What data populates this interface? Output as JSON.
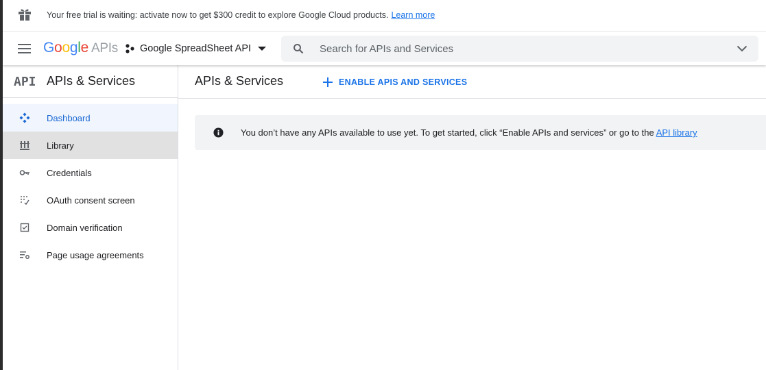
{
  "banner": {
    "text": "Your free trial is waiting: activate now to get $300 credit to explore Google Cloud products.",
    "link_label": "Learn more",
    "icon": "gift-icon"
  },
  "header": {
    "logo_google": [
      "G",
      "o",
      "o",
      "g",
      "l",
      "e"
    ],
    "logo_suffix": "APIs",
    "project_name": "Google SpreadSheet API",
    "search_placeholder": "Search for APIs and Services",
    "search_value": ""
  },
  "sidebar": {
    "header_glyph": "API",
    "title": "APIs & Services",
    "items": [
      {
        "label": "Dashboard",
        "icon": "dashboard-icon",
        "active": true
      },
      {
        "label": "Library",
        "icon": "library-icon",
        "hovered": true
      },
      {
        "label": "Credentials",
        "icon": "key-icon"
      },
      {
        "label": "OAuth consent screen",
        "icon": "consent-screen-icon"
      },
      {
        "label": "Domain verification",
        "icon": "checkbox-icon"
      },
      {
        "label": "Page usage agreements",
        "icon": "settings-list-icon"
      }
    ]
  },
  "main": {
    "title": "APIs & Services",
    "enable_button_label": "ENABLE APIS AND SERVICES",
    "notice": {
      "text": "You don’t have any APIs available to use yet. To get started, click “Enable APIs and services” or go to the",
      "link_label": "API library"
    }
  },
  "colors": {
    "accent": "#1a73e8",
    "active_nav_bg": "#f0f5fe",
    "hover_nav_bg": "#e1e1e1",
    "notice_bg": "#f1f3f4"
  }
}
